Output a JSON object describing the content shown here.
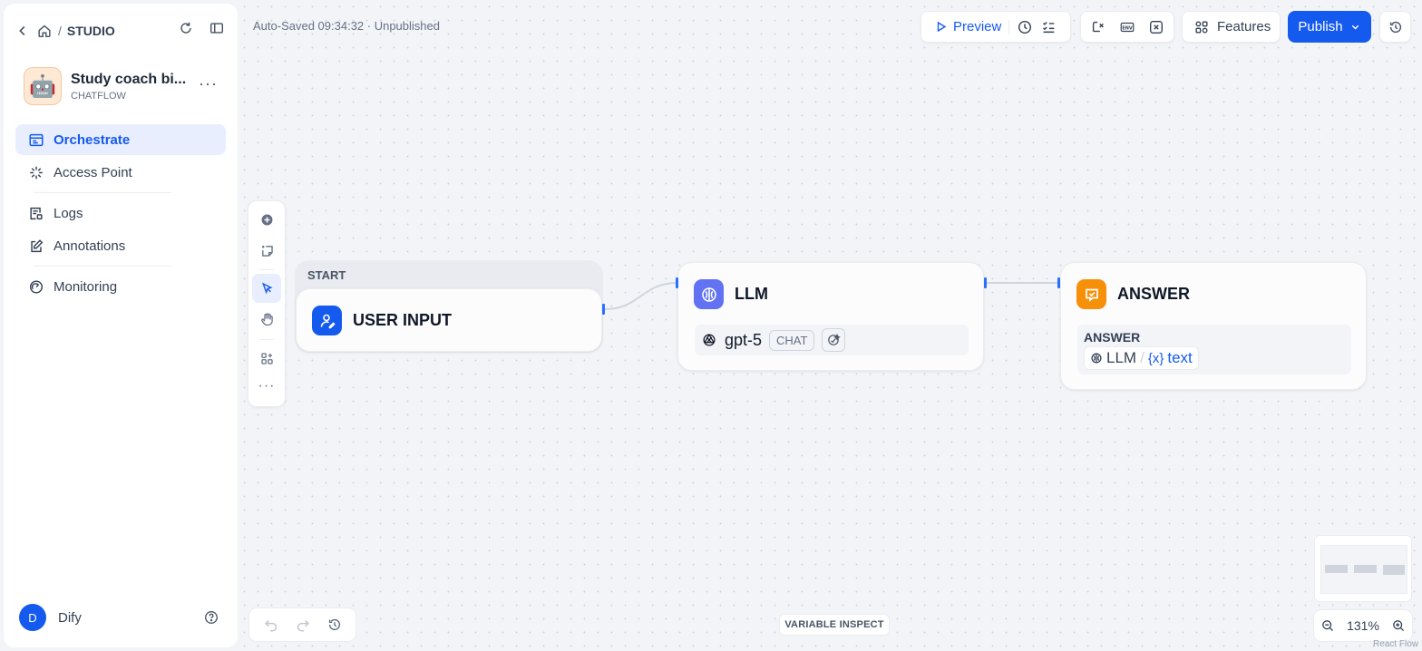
{
  "sidebar": {
    "breadcrumb": "STUDIO",
    "app_name": "Study coach bi...",
    "app_type": "CHATFLOW",
    "app_emoji": "🤖",
    "nav": [
      {
        "label": "Orchestrate",
        "icon": "orchestrate-icon",
        "active": true
      },
      {
        "label": "Access Point",
        "icon": "access-point-icon",
        "active": false
      },
      {
        "label": "Logs",
        "icon": "logs-icon",
        "active": false
      },
      {
        "label": "Annotations",
        "icon": "annotations-icon",
        "active": false
      },
      {
        "label": "Monitoring",
        "icon": "monitoring-icon",
        "active": false
      }
    ],
    "user": {
      "initial": "D",
      "name": "Dify"
    }
  },
  "header": {
    "autosave": "Auto-Saved 09:34:32 · Unpublished",
    "preview_label": "Preview",
    "features_label": "Features",
    "publish_label": "Publish"
  },
  "nodes": {
    "start": {
      "group_label": "START",
      "title": "USER INPUT"
    },
    "llm": {
      "title": "LLM",
      "model": "gpt-5",
      "mode_badge": "CHAT"
    },
    "answer": {
      "title": "ANSWER",
      "field_label": "ANSWER",
      "var_node": "LLM",
      "var_sep": "/",
      "var_name": "text"
    }
  },
  "footer": {
    "variable_inspect": "VARIABLE INSPECT",
    "zoom": "131%",
    "attribution": "React Flow"
  },
  "colors": {
    "accent": "#155aef",
    "start_icon_bg": "#155aef",
    "llm_icon_bg": "#6172f3",
    "answer_icon_bg": "#f79009"
  }
}
